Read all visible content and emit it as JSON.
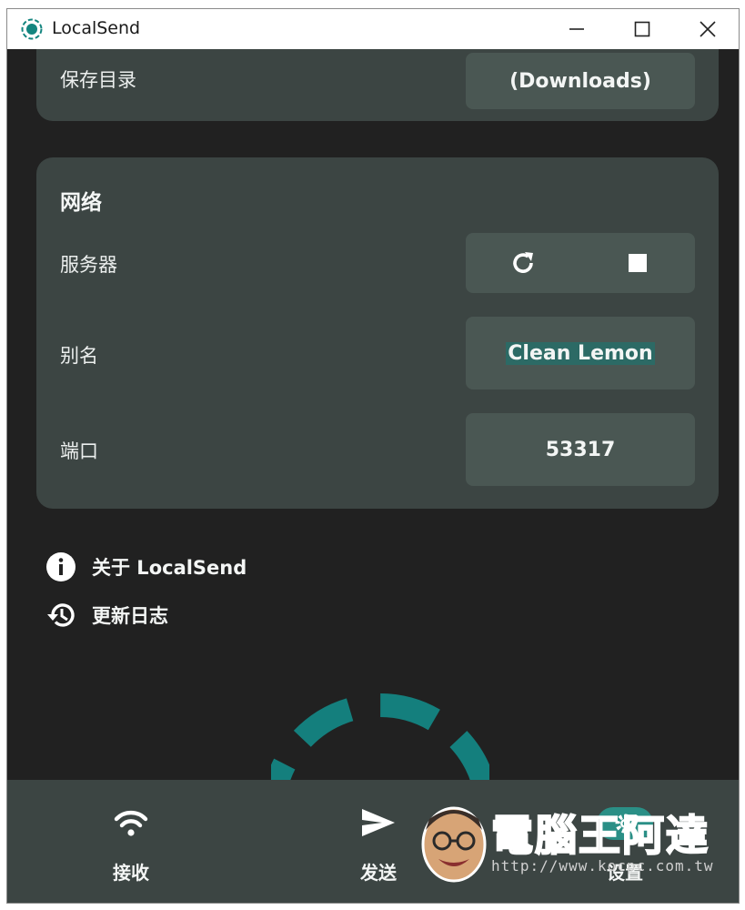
{
  "window": {
    "title": "LocalSend"
  },
  "storage": {
    "label": "保存目录",
    "value": "(Downloads)"
  },
  "network": {
    "title": "网络",
    "server_label": "服务器",
    "alias_label": "别名",
    "alias_value": "Clean Lemon",
    "port_label": "端口",
    "port_value": "53317"
  },
  "links": {
    "about": "关于 LocalSend",
    "changelog": "更新日志"
  },
  "bottom_nav": {
    "receive": "接收",
    "send": "发送",
    "settings": "设置"
  },
  "watermark": {
    "title": "電腦王阿達",
    "url": "http://www.kocpc.com.tw"
  },
  "colors": {
    "background": "#212121",
    "card": "#3c4543",
    "value_box": "#4a5753",
    "accent": "#2a8f86",
    "ring": "#147f7d"
  }
}
